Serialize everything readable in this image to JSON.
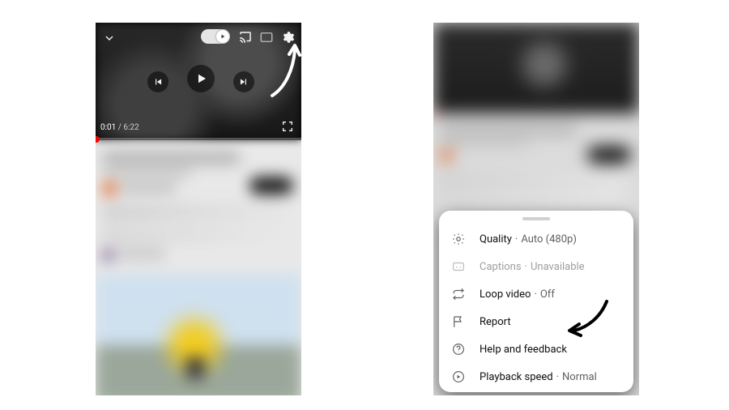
{
  "player": {
    "current_time": "0:01",
    "duration": "6:22",
    "autoplay_on": true
  },
  "icons": {
    "chevron_down": "chevron-down-icon",
    "autoplay": "autoplay-toggle",
    "cast": "cast-icon",
    "cc": "captions-icon",
    "gear": "gear-icon",
    "prev": "previous-icon",
    "play": "play-icon",
    "next": "next-icon",
    "fullscreen": "fullscreen-icon",
    "loop": "loop-icon",
    "report": "flag-icon",
    "help": "help-icon",
    "speed": "play-circle-icon",
    "quality": "gear-icon"
  },
  "menu": {
    "items": [
      {
        "id": "quality",
        "label": "Quality",
        "value": "Auto (480p)",
        "icon": "gear",
        "disabled": false
      },
      {
        "id": "captions",
        "label": "Captions",
        "value": "Unavailable",
        "icon": "cc",
        "disabled": true
      },
      {
        "id": "loop",
        "label": "Loop video",
        "value": "Off",
        "icon": "loop",
        "disabled": false
      },
      {
        "id": "report",
        "label": "Report",
        "value": "",
        "icon": "report",
        "disabled": false
      },
      {
        "id": "help",
        "label": "Help and feedback",
        "value": "",
        "icon": "help",
        "disabled": false
      },
      {
        "id": "speed",
        "label": "Playback speed",
        "value": "Normal",
        "icon": "speed",
        "disabled": false
      }
    ]
  },
  "annotations": {
    "left_arrow_target": "gear-icon",
    "right_arrow_target": "menu-item-loop"
  }
}
